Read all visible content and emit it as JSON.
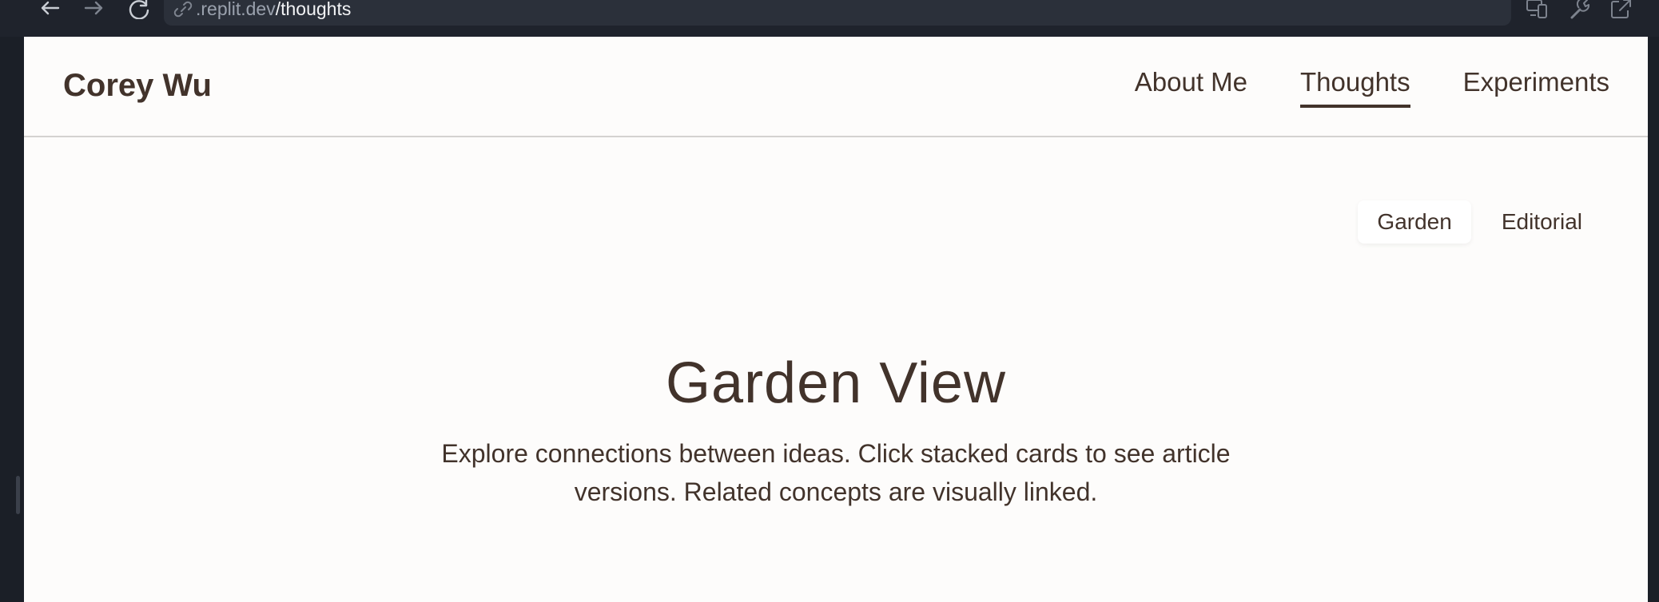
{
  "browser": {
    "url_domain": ".replit.dev",
    "url_path": "/thoughts",
    "icons": [
      "back-arrow-icon",
      "forward-arrow-icon",
      "reload-icon",
      "link-icon",
      "devices-icon",
      "wrench-icon",
      "open-external-icon"
    ]
  },
  "site": {
    "title": "Corey Wu"
  },
  "nav": {
    "items": [
      {
        "label": "About Me"
      },
      {
        "label": "Thoughts"
      },
      {
        "label": "Experiments"
      }
    ],
    "active": "Thoughts"
  },
  "view_toggle": {
    "garden_label": "Garden",
    "editorial_label": "Editorial",
    "active": "Garden"
  },
  "hero": {
    "title": "Garden View",
    "line1": "Explore connections between ideas. Click stacked cards to see article",
    "line2": "versions. Related concepts are visually linked."
  },
  "colors": {
    "text": "#42332b",
    "page_bg": "#fdfcfb",
    "chrome_bg": "#1f232c"
  }
}
